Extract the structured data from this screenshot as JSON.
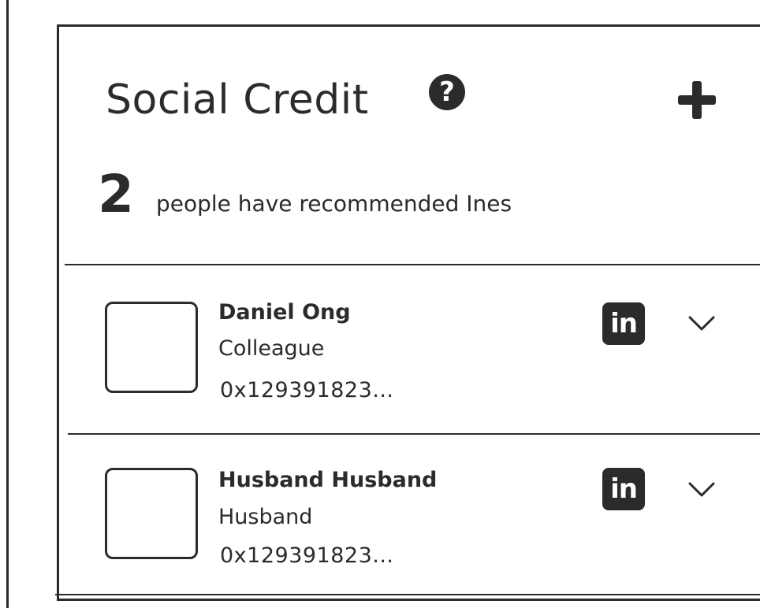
{
  "header": {
    "title": "Social Credit",
    "help_icon": "question-circle-icon",
    "help_glyph": "?",
    "add_icon": "plus-icon"
  },
  "summary": {
    "count": "2",
    "text": "people have recommended Ines"
  },
  "recommendations": [
    {
      "name": "Daniel Ong",
      "relation": "Colleague",
      "address": "0x129391823...",
      "social_icon": "linkedin-icon",
      "social_glyph": "in",
      "expand_icon": "chevron-down-icon"
    },
    {
      "name": "Husband Husband",
      "relation": "Husband",
      "address": "0x129391823...",
      "social_icon": "linkedin-icon",
      "social_glyph": "in",
      "expand_icon": "chevron-down-icon"
    }
  ],
  "colors": {
    "ink": "#2b2b2b",
    "background": "#ffffff"
  }
}
